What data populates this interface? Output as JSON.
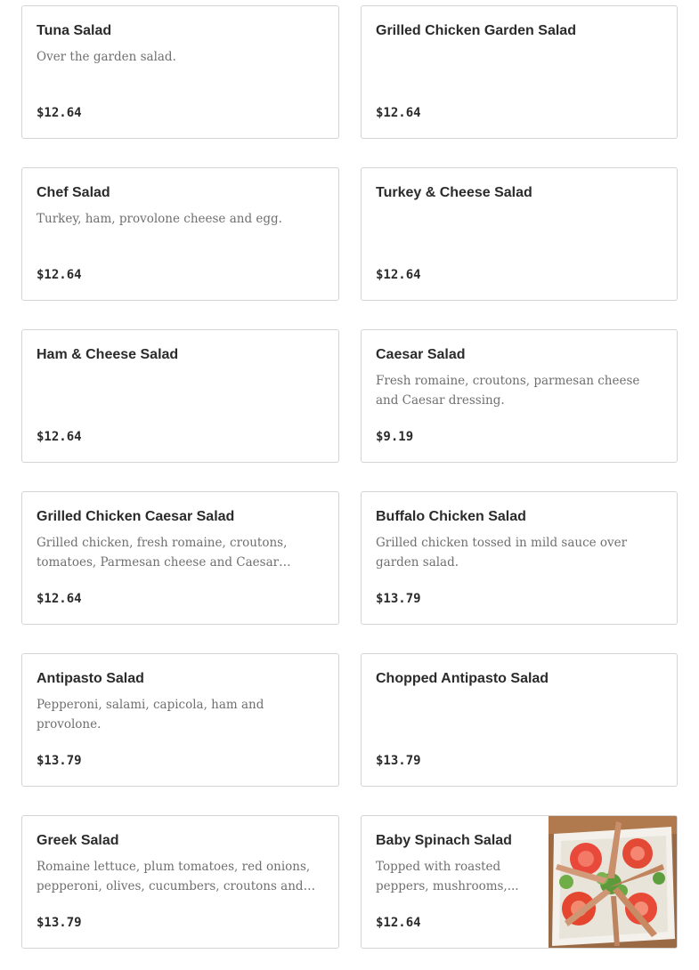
{
  "menu": {
    "items": [
      {
        "name": "Tuna Salad",
        "description": "Over the garden salad.",
        "price": "$12.64"
      },
      {
        "name": "Grilled Chicken Garden Salad",
        "description": "",
        "price": "$12.64"
      },
      {
        "name": "Chef Salad",
        "description": "Turkey, ham, provolone cheese and egg.",
        "price": "$12.64"
      },
      {
        "name": "Turkey & Cheese Salad",
        "description": "",
        "price": "$12.64"
      },
      {
        "name": "Ham & Cheese Salad",
        "description": "",
        "price": "$12.64"
      },
      {
        "name": "Caesar Salad",
        "description": "Fresh romaine, croutons, parmesan cheese and Caesar dressing.",
        "price": "$9.19"
      },
      {
        "name": "Grilled Chicken Caesar Salad",
        "description": "Grilled chicken, fresh romaine, croutons, tomatoes, Parmesan cheese and Caesar dressing.",
        "price": "$12.64"
      },
      {
        "name": "Buffalo Chicken Salad",
        "description": "Grilled chicken tossed in mild sauce over garden salad.",
        "price": "$13.79"
      },
      {
        "name": "Antipasto Salad",
        "description": "Pepperoni, salami, capicola, ham and provolone.",
        "price": "$13.79"
      },
      {
        "name": "Chopped Antipasto Salad",
        "description": "",
        "price": "$13.79"
      },
      {
        "name": "Greek Salad",
        "description": "Romaine lettuce, plum tomatoes, red onions, pepperoni, olives, cucumbers, croutons and feta...",
        "price": "$13.79"
      },
      {
        "name": "Baby Spinach Salad",
        "description": "Topped with roasted peppers, mushrooms,...",
        "price": "$12.64"
      }
    ]
  }
}
